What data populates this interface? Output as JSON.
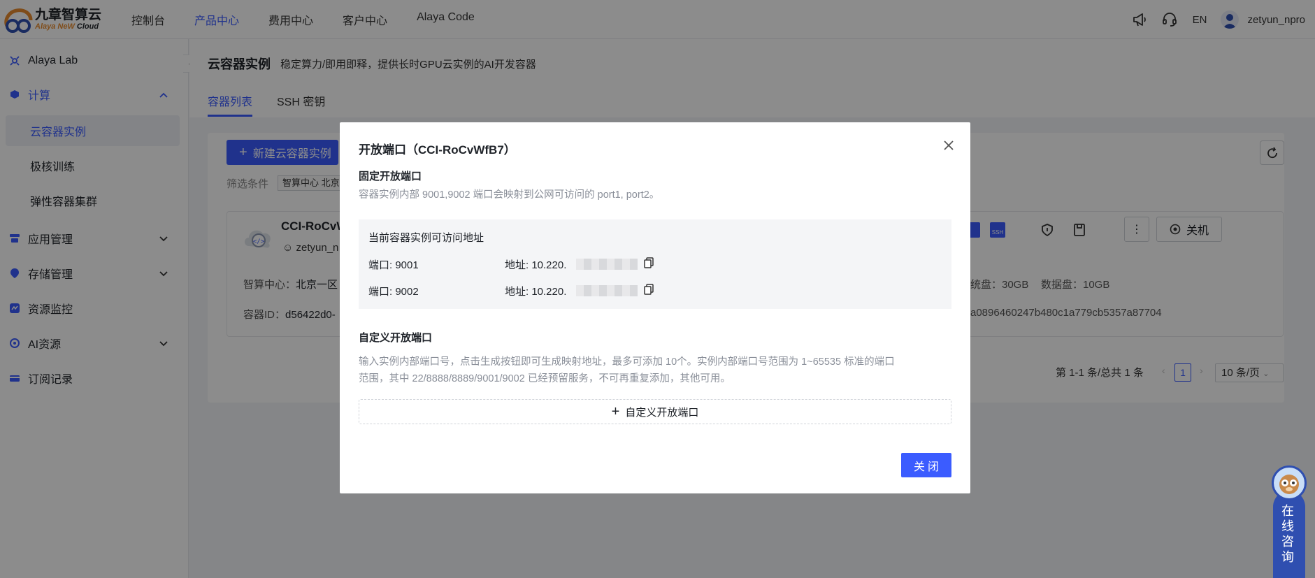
{
  "brand": {
    "name_cn": "九章智算云",
    "name_en_1": "Alaya NeW",
    "name_en_2": "Cloud"
  },
  "nav": [
    "控制台",
    "产品中心",
    "费用中心",
    "客户中心",
    "Alaya Code"
  ],
  "nav_active_index": 1,
  "topbar": {
    "lang": "EN",
    "username": "zetyun_npro"
  },
  "sidebar": {
    "items": [
      {
        "label": "Alaya Lab",
        "icon": "lab-icon"
      },
      {
        "label": "计算",
        "icon": "compute-icon",
        "expanded": true
      },
      {
        "label": "云容器实例",
        "sub": true,
        "active": true
      },
      {
        "label": "极核训练",
        "sub": true
      },
      {
        "label": "弹性容器集群",
        "sub": true
      },
      {
        "label": "应用管理",
        "icon": "app-icon"
      },
      {
        "label": "存储管理",
        "icon": "storage-icon"
      },
      {
        "label": "资源监控",
        "icon": "monitor-icon"
      },
      {
        "label": "AI资源",
        "icon": "ai-icon"
      },
      {
        "label": "订阅记录",
        "icon": "subscription-icon"
      }
    ]
  },
  "page": {
    "title": "云容器实例",
    "description": "稳定算力/即用即释，提供长时GPU云实例的AI开发容器",
    "tabs": [
      "容器列表",
      "SSH 密钥"
    ]
  },
  "list": {
    "new_button": "新建云容器实例",
    "filter_label": "筛选条件",
    "filter_tag": "智算中心 北京",
    "instance": {
      "name": "CCI-RoCvW",
      "user": "zetyun_n",
      "center_label": "智算中心：",
      "center_value": "北京一区",
      "id_label": "容器ID：",
      "id_value": "d56422d0-",
      "sys_disk": "统盘：30GB",
      "data_disk": "数据盘：10GB",
      "id_tail": "a0896460247b480c1a779cb5357a87704",
      "shutdown_label": "关机"
    },
    "pager": {
      "summary": "第 1-1 条/总共 1 条",
      "page": "1",
      "page_size": "10 条/页"
    }
  },
  "modal": {
    "title": "开放端口（CCI-RoCvWfB7）",
    "fixed_section": "固定开放端口",
    "fixed_desc": "容器实例内部 9001,9002 端口会映射到公网可访问的 port1, port2。",
    "box_title": "当前容器实例可访问地址",
    "ports": [
      {
        "port": "端口: 9001",
        "address": "地址: 10.220."
      },
      {
        "port": "端口: 9002",
        "address": "地址: 10.220."
      }
    ],
    "custom_section": "自定义开放端口",
    "custom_desc_1": "输入实例内部端口号，点击生成按钮即可生成映射地址，最多可添加 10个。实例内部端口号范围为 1~65535 标准的端口",
    "custom_desc_2": "范围，其中 22/8888/8889/9001/9002 已经预留服务，不可再重复添加，其他可用。",
    "add_button": "自定义开放端口",
    "close_button": "关闭"
  },
  "consult": {
    "label": "在线咨询"
  },
  "colors": {
    "accent": "#3b5cff",
    "overlay": "rgba(0,0,0,0.45)",
    "consult": "#2f4fb0"
  }
}
